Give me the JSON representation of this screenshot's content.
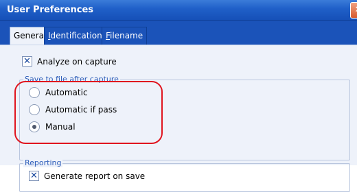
{
  "window": {
    "title": "User Preferences",
    "close_glyph": "✕"
  },
  "tabs": [
    {
      "label": "General",
      "active": true
    },
    {
      "label": "Identification",
      "underline": "I",
      "rest": "dentification",
      "active": false
    },
    {
      "label": "Filename",
      "underline": "F",
      "rest": "ilename",
      "active": false
    }
  ],
  "general": {
    "analyze_on_capture": {
      "label": "Analyze on capture",
      "checked": true
    },
    "save_group": {
      "title": "Save to file after capture",
      "options": [
        {
          "label": "Automatic",
          "selected": false
        },
        {
          "label": "Automatic if pass",
          "selected": false
        },
        {
          "label": "Manual",
          "selected": true
        }
      ]
    },
    "reporting_group": {
      "title": "Reporting",
      "generate_report": {
        "label": "Generate report on save",
        "checked": true
      }
    }
  },
  "colors": {
    "titlebar": "#1f5fc8",
    "panel_bg": "#eef2fa",
    "group_title": "#2a5bb8",
    "highlight": "#e0141e"
  }
}
